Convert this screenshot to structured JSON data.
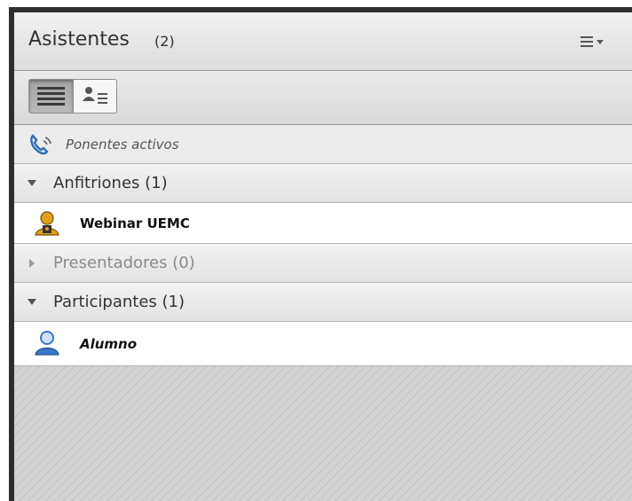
{
  "header": {
    "title": "Asistentes",
    "count": "(2)",
    "menu_icon": "list-menu-icon"
  },
  "toolbar": {
    "views": [
      {
        "icon": "list-view-icon",
        "active": true
      },
      {
        "icon": "user-details-view-icon",
        "active": false
      }
    ]
  },
  "active_speakers": {
    "icon": "phone-speaking-icon",
    "label": "Ponentes activos"
  },
  "groups": [
    {
      "label": "Anfitriones (1)",
      "expanded": true,
      "members": [
        {
          "name": "Webinar UEMC",
          "role_icon": "host-icon"
        }
      ]
    },
    {
      "label": "Presentadores (0)",
      "expanded": false,
      "members": []
    },
    {
      "label": "Participantes (1)",
      "expanded": true,
      "members": [
        {
          "name": "Alumno",
          "role_icon": "participant-icon"
        }
      ]
    }
  ],
  "colors": {
    "frame": "#2e2e2e",
    "host_icon": "#e0a020",
    "participant_icon": "#3a78c8"
  }
}
